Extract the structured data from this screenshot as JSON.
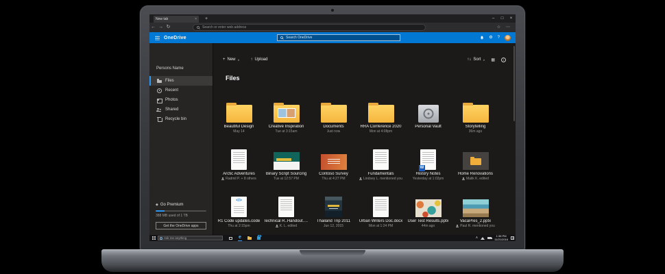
{
  "browser": {
    "tab_title": "New tab",
    "address_placeholder": "Search or enter web address"
  },
  "onedrive": {
    "app_title": "OneDrive",
    "search_placeholder": "Search OneDrive",
    "toolbar": {
      "new": "New",
      "upload": "Upload",
      "sort": "Sort"
    },
    "sidebar": {
      "account": "Persons Name",
      "items": [
        {
          "label": "Files",
          "selected": true
        },
        {
          "label": "Recent"
        },
        {
          "label": "Photos"
        },
        {
          "label": "Shared"
        },
        {
          "label": "Recycle bin"
        }
      ],
      "premium": "Go Premium",
      "storage": "388 MB used of 1 TB",
      "apps_button": "Get the OneDrive apps"
    },
    "files": {
      "heading": "Files",
      "items": [
        {
          "name": "Beautiful Design",
          "subtitle": "May 14",
          "kind": "folder"
        },
        {
          "name": "Creative Inspiration",
          "subtitle": "Tue at 3:15am",
          "kind": "folder-photos"
        },
        {
          "name": "Documents",
          "subtitle": "Just now",
          "kind": "folder"
        },
        {
          "name": "RRA Conference 2020",
          "subtitle": "Mon at 4:08pm",
          "kind": "folder"
        },
        {
          "name": "Personal Vault",
          "subtitle": "",
          "kind": "vault"
        },
        {
          "name": "Storytelling",
          "subtitle": "36m ago",
          "kind": "folder"
        },
        {
          "name": "Arctic Adventures",
          "subtitle": "Radmil P. + 8 others",
          "kind": "doc",
          "shared": true
        },
        {
          "name": "Binary Script Sourcing",
          "subtitle": "Tue at 12:57 PM",
          "kind": "slide-teal"
        },
        {
          "name": "Contoso Survey",
          "subtitle": "Thu at 4:27 PM",
          "kind": "tile-orange"
        },
        {
          "name": "Fundamentals",
          "subtitle": "Lindsey L. mentioned you",
          "kind": "doc",
          "shared": true
        },
        {
          "name": "History Notes",
          "subtitle": "Yesterday at 1:02pm",
          "kind": "doc-word"
        },
        {
          "name": "Home Renovations",
          "subtitle": "Malik K. edited",
          "kind": "tile-dark-folder",
          "shared": true
        },
        {
          "name": "R1 Code updates.code",
          "subtitle": "Thu at 2:15pm",
          "kind": "doc-code"
        },
        {
          "name": "Technical R..Handout.pptx",
          "subtitle": "K. L. edited",
          "kind": "doc",
          "shared": true
        },
        {
          "name": "Thailand Trip 2011",
          "subtitle": "Jun 12, 2015",
          "kind": "photo-thailand"
        },
        {
          "name": "Urban Writers Doc.docx",
          "subtitle": "Mon at 1:24 PM",
          "kind": "doc"
        },
        {
          "name": "User Test Results.pptx",
          "subtitle": "44m ago",
          "kind": "photo-map"
        },
        {
          "name": "VacaPres_2.pptx",
          "subtitle": "Paul R. mentioned you",
          "kind": "photo-beach",
          "shared": true
        }
      ]
    }
  },
  "taskbar": {
    "search_placeholder": "Ask me anything",
    "time": "1:38 PM",
    "date": "11/21/2016"
  },
  "icons": {
    "plus": "+",
    "close": "×",
    "minimize": "–",
    "maximize": "□",
    "back": "←",
    "forward": "→",
    "refresh": "↻",
    "star": "☆",
    "more": "⋯",
    "chevron_down": "∨",
    "chevron_up": "∧",
    "upload_arrow": "↑",
    "sort_arrows": "↑↓",
    "grid_view": "▦",
    "info": "i",
    "gear": "⚙",
    "help": "?",
    "premium_diamond": "◆",
    "edge": "e"
  },
  "colors": {
    "accent": "#0078d4",
    "folder_yellow": "#f5b63e"
  }
}
